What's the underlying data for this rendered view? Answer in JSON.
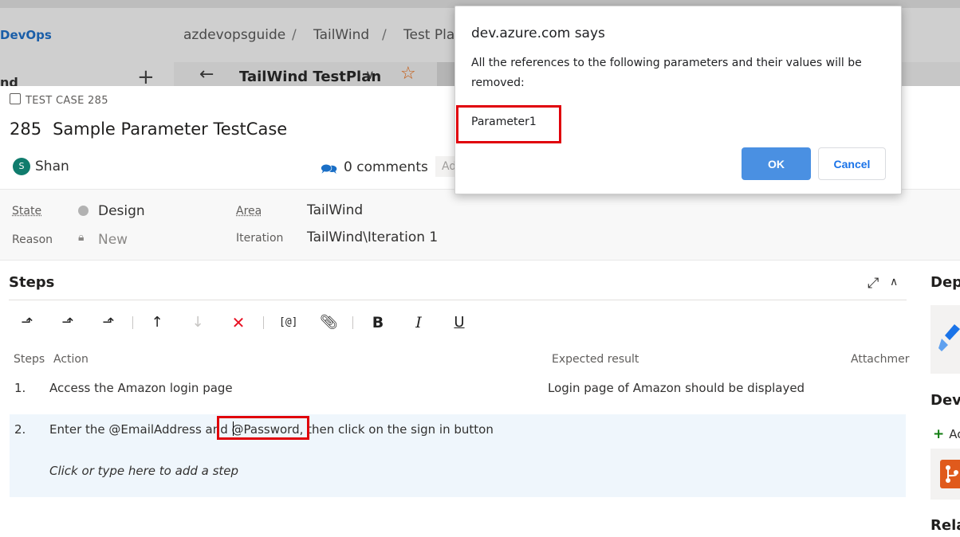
{
  "app": {
    "brand": "DevOps",
    "breadcrumbs": [
      "azdevopsguide",
      "TailWind",
      "Test Plan"
    ],
    "left_panel_label": "nd",
    "test_plan_name": "TailWind TestPlan"
  },
  "work_item": {
    "type_label": "TEST CASE 285",
    "id": "285",
    "title": "Sample Parameter TestCase",
    "assignee_initial": "S",
    "assignee": "Shan",
    "comments": "0 comments",
    "add_tag": "Ad"
  },
  "fields": {
    "state_label": "State",
    "state_value": "Design",
    "reason_label": "Reason",
    "reason_value": "New",
    "area_label": "Area",
    "area_value": "TailWind",
    "iteration_label": "Iteration",
    "iteration_value": "TailWind\\Iteration 1"
  },
  "steps": {
    "title": "Steps",
    "toolbar": {
      "param_label": "[@]",
      "bold_label": "B",
      "italic_label": "I",
      "underline_label": "U"
    },
    "columns": {
      "steps": "Steps",
      "action": "Action",
      "expected": "Expected result",
      "attachments": "Attachmer"
    },
    "rows": [
      {
        "num": "1.",
        "action": "Access the Amazon login page",
        "expected": "Login page of Amazon should be displayed"
      },
      {
        "num": "2.",
        "action": "Enter the @EmailAddress and @Password, then click on the sign in button",
        "expected": ""
      }
    ],
    "add_step_placeholder": "Click or type here to add a step"
  },
  "right_panel": {
    "deployment_title": "Dep",
    "development_title": "Deve",
    "add_link_label": "Ac",
    "related_title": "Rela"
  },
  "dialog": {
    "title": "dev.azure.com says",
    "message": "All the references to the following parameters and their values will be removed:",
    "parameter": "Parameter1",
    "ok_label": "OK",
    "cancel_label": "Cancel"
  },
  "colors": {
    "accent_blue": "#4a90e2",
    "highlight_red": "#e0000a",
    "avatar_green": "#107c6d",
    "delete_red": "#e81123"
  }
}
